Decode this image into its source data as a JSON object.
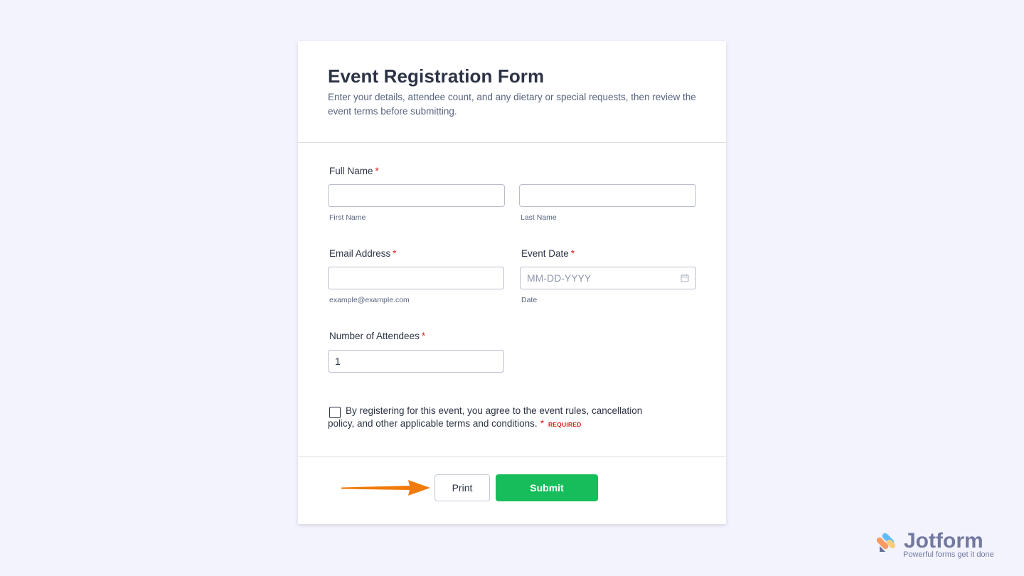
{
  "form": {
    "title": "Event Registration Form",
    "description": "Enter your details, attendee count, and any dietary or special requests, then review the event terms before submitting."
  },
  "fields": {
    "full_name": {
      "label": "Full Name",
      "required_mark": "*",
      "first_sublabel": "First Name",
      "last_sublabel": "Last Name",
      "first_value": "",
      "last_value": ""
    },
    "email": {
      "label": "Email Address",
      "required_mark": "*",
      "sublabel": "example@example.com",
      "value": ""
    },
    "event_date": {
      "label": "Event Date",
      "required_mark": "*",
      "placeholder": "MM-DD-YYYY",
      "sublabel": "Date",
      "icon": "calendar-icon"
    },
    "attendees": {
      "label": "Number of Attendees",
      "required_mark": "*",
      "value": "1"
    }
  },
  "terms": {
    "text": "By registering for this event, you agree to the event rules, cancellation policy, and other applicable terms and conditions.",
    "required_mark": "*",
    "required_tag": "REQUIRED",
    "checked": false
  },
  "buttons": {
    "print_label": "Print",
    "submit_label": "Submit"
  },
  "annotation": {
    "icon": "arrow-icon",
    "color": "#f07a0a"
  },
  "brand": {
    "name": "Jotform",
    "tagline": "Powerful forms get it done"
  },
  "colors": {
    "background": "#f3f3fe",
    "submit": "#18bd5b",
    "required": "#e01e1e"
  }
}
